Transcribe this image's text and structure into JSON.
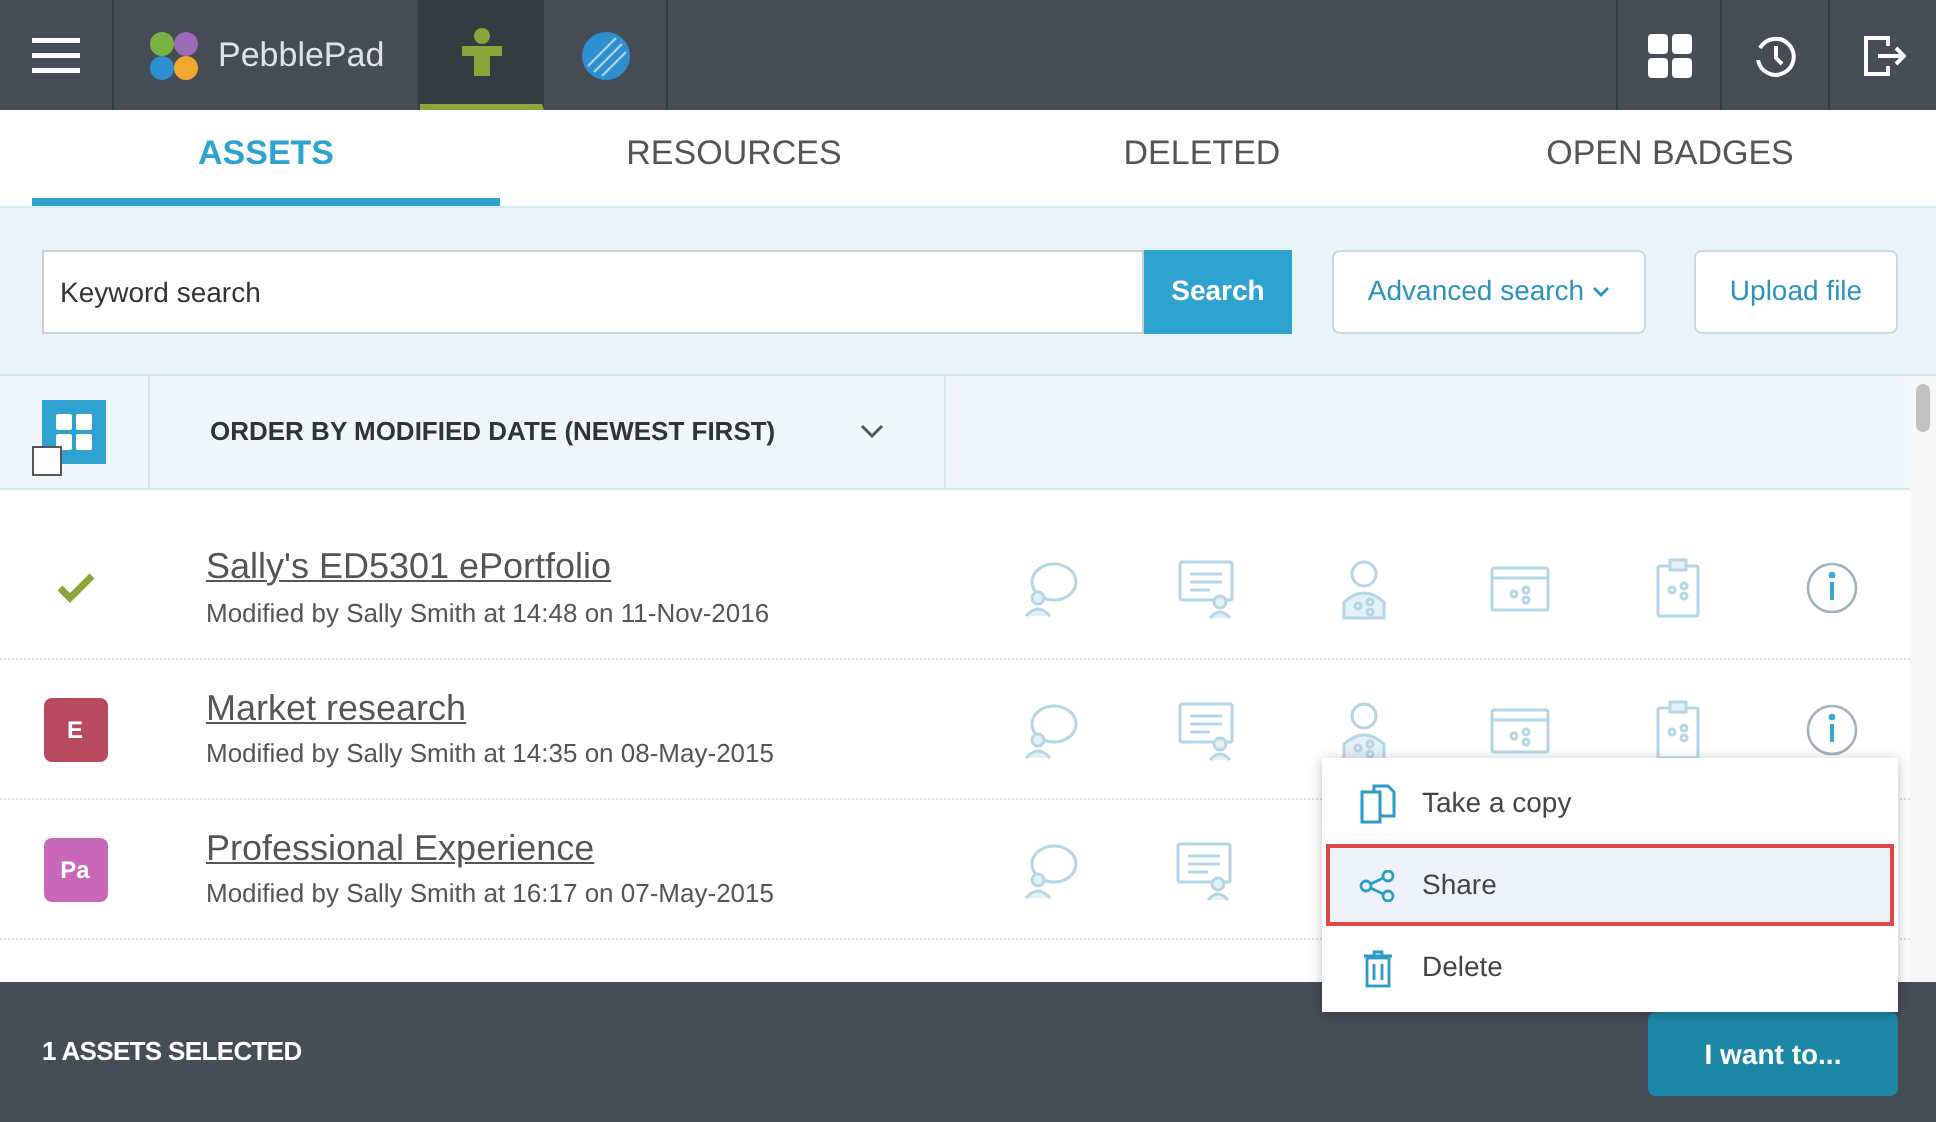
{
  "topbar": {
    "brand": "PebblePad",
    "apps": [
      {
        "selected": true
      },
      {
        "selected": false
      }
    ]
  },
  "tabs": [
    {
      "label": "ASSETS",
      "selected": true
    },
    {
      "label": "RESOURCES",
      "selected": false
    },
    {
      "label": "DELETED",
      "selected": false
    },
    {
      "label": "OPEN BADGES",
      "selected": false
    }
  ],
  "search": {
    "placeholder": "Keyword search",
    "button": "Search",
    "advanced": "Advanced search",
    "upload": "Upload file"
  },
  "order": {
    "label": "ORDER BY MODIFIED DATE (NEWEST FIRST)",
    "select_all_checked": false
  },
  "rows": [
    {
      "title": "Sally's ED5301 ePortfolio",
      "subtitle": "Modified by Sally Smith at 14:48 on 11-Nov-2016",
      "selected": true
    },
    {
      "title": "Market research",
      "subtitle": "Modified by Sally Smith at 14:35 on 08-May-2015",
      "selected": false,
      "badge": "E",
      "color": "#b74a5e"
    },
    {
      "title": "Professional Experience",
      "subtitle": "Modified by Sally Smith at 16:17 on 07-May-2015",
      "selected": false,
      "badge": "Pa",
      "color": "#c967b8"
    }
  ],
  "menu": [
    {
      "label": "Take a copy",
      "kind": "copy",
      "selected": false
    },
    {
      "label": "Share",
      "kind": "share",
      "selected": true
    },
    {
      "label": "Delete",
      "kind": "delete",
      "selected": false
    }
  ],
  "footer": {
    "status": "1 ASSETS SELECTED",
    "button": "I want to..."
  }
}
